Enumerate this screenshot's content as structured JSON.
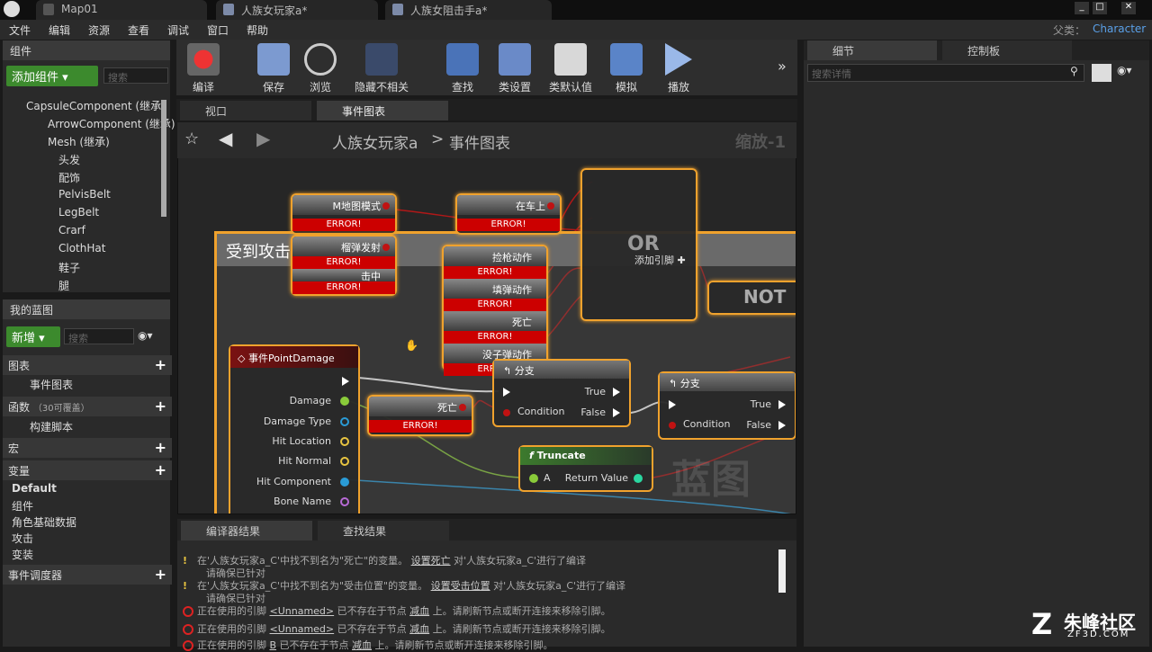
{
  "titlebar": {
    "tabs": [
      "Map01",
      "人族女玩家a*",
      "人族女阻击手a*"
    ],
    "parent_label": "父类：",
    "parent_value": "Character"
  },
  "menu": [
    "文件",
    "编辑",
    "资源",
    "查看",
    "调试",
    "窗口",
    "帮助"
  ],
  "components": {
    "header": "组件",
    "add_button": "添加组件",
    "search_placeholder": "搜索",
    "items": [
      "CapsuleComponent (继承)",
      "ArrowComponent (继承)",
      "Mesh (继承)",
      "头发",
      "配饰",
      "PelvisBelt",
      "LegBelt",
      "Crarf",
      "ClothHat",
      "鞋子",
      "腿"
    ]
  },
  "myblueprint": {
    "header": "我的蓝图",
    "new_button": "新增",
    "search_placeholder": "搜索",
    "graphs": "图表",
    "event_graph": "事件图表",
    "functions": "函数",
    "functions_count": "（30可覆盖）",
    "construct": "构建脚本",
    "macros": "宏",
    "variables": "变量",
    "var_items": [
      "Default",
      "组件",
      "角色基础数据",
      "攻击",
      "变装"
    ],
    "dispatchers": "事件调度器"
  },
  "toolbar": [
    {
      "label": "编译",
      "icon": "compile-icon"
    },
    {
      "label": "保存",
      "icon": "save-icon"
    },
    {
      "label": "浏览",
      "icon": "browse-icon"
    },
    {
      "label": "隐藏不相关",
      "icon": "hide-unrelated-icon"
    },
    {
      "label": "查找",
      "icon": "find-icon"
    },
    {
      "label": "类设置",
      "icon": "class-settings-icon"
    },
    {
      "label": "类默认值",
      "icon": "class-defaults-icon"
    },
    {
      "label": "模拟",
      "icon": "simulate-icon"
    },
    {
      "label": "播放",
      "icon": "play-icon"
    }
  ],
  "editor_tabs": {
    "viewport": "视口",
    "event_graph": "事件图表"
  },
  "breadcrumb": {
    "bp": "人族女玩家a",
    "sep": ">",
    "graph": "事件图表",
    "zoom": "缩放-1"
  },
  "graph": {
    "comment": "受到攻击",
    "watermark": "蓝图",
    "nodes": {
      "n1": "M地图模式",
      "n2": "榴弹发射",
      "n3": "击中",
      "n4": "在车上",
      "n5": "捡枪动作",
      "n6": "填弹动作",
      "n7": "死亡",
      "n8": "没子弹动作",
      "n9": "死亡",
      "or": "OR",
      "or_add": "添加引脚",
      "not": "NOT",
      "event": "事件PointDamage",
      "event_pins": [
        "Damage",
        "Damage Type",
        "Hit Location",
        "Hit Normal",
        "Hit Component",
        "Bone Name"
      ],
      "branch": "分支",
      "condition": "Condition",
      "true": "True",
      "false": "False",
      "truncate": "Truncate",
      "a": "A",
      "return_value": "Return Value",
      "error": "ERROR!"
    }
  },
  "details": {
    "header": "细节",
    "control": "控制板",
    "search_placeholder": "搜索详情"
  },
  "results": {
    "tabs": [
      "编译器结果",
      "查找结果"
    ],
    "lines": [
      {
        "a": "在'人族女玩家a_C'中找不到名为\"死亡\"的变量。",
        "b": "设置死亡",
        "c": "对'人族女玩家a_C'进行了编译",
        "d": "请确保已针对"
      },
      {
        "a": "在'人族女玩家a_C'中找不到名为\"受击位置\"的变量。",
        "b": "设置受击位置",
        "c": "对'人族女玩家a_C'进行了编译",
        "d": "请确保已针对"
      },
      {
        "a": "正在使用的引脚",
        "b": "<Unnamed>",
        "c": "已不存在于节点",
        "d": "减血",
        "e": "上。请刷新节点或断开连接来移除引脚。"
      },
      {
        "a": "正在使用的引脚",
        "b": "<Unnamed>",
        "c": "已不存在于节点",
        "d": "减血",
        "e": "上。请刷新节点或断开连接来移除引脚。"
      },
      {
        "a": "正在使用的引脚",
        "b": "B",
        "c": "已不存在于节点",
        "d": "减血",
        "e": "上。请刷新节点或断开连接来移除引脚。"
      }
    ]
  },
  "watermark": {
    "name": "朱峰社区",
    "url": "ZF3D.COM"
  }
}
